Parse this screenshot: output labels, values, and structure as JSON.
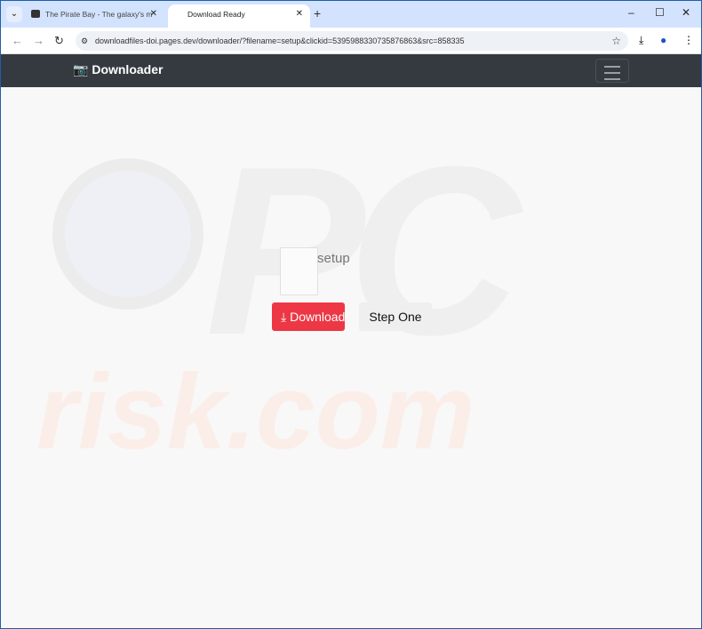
{
  "browser": {
    "tabs": [
      {
        "title": "The Pirate Bay - The galaxy's m",
        "active": false
      },
      {
        "title": "Download Ready",
        "active": true
      }
    ],
    "url": "downloadfiles-doi.pages.dev/downloader/?filename=setup&clickid=5395988330735876863&src=858335"
  },
  "navbar": {
    "brand": "Downloader",
    "brand_icon": "camera-icon"
  },
  "file": {
    "name": "setup",
    "icon": "zip-file-icon"
  },
  "buttons": {
    "download": "Download",
    "step_one": "Step One",
    "download_color": "#ed3745"
  },
  "watermark": {
    "text": "PC risk.com"
  }
}
